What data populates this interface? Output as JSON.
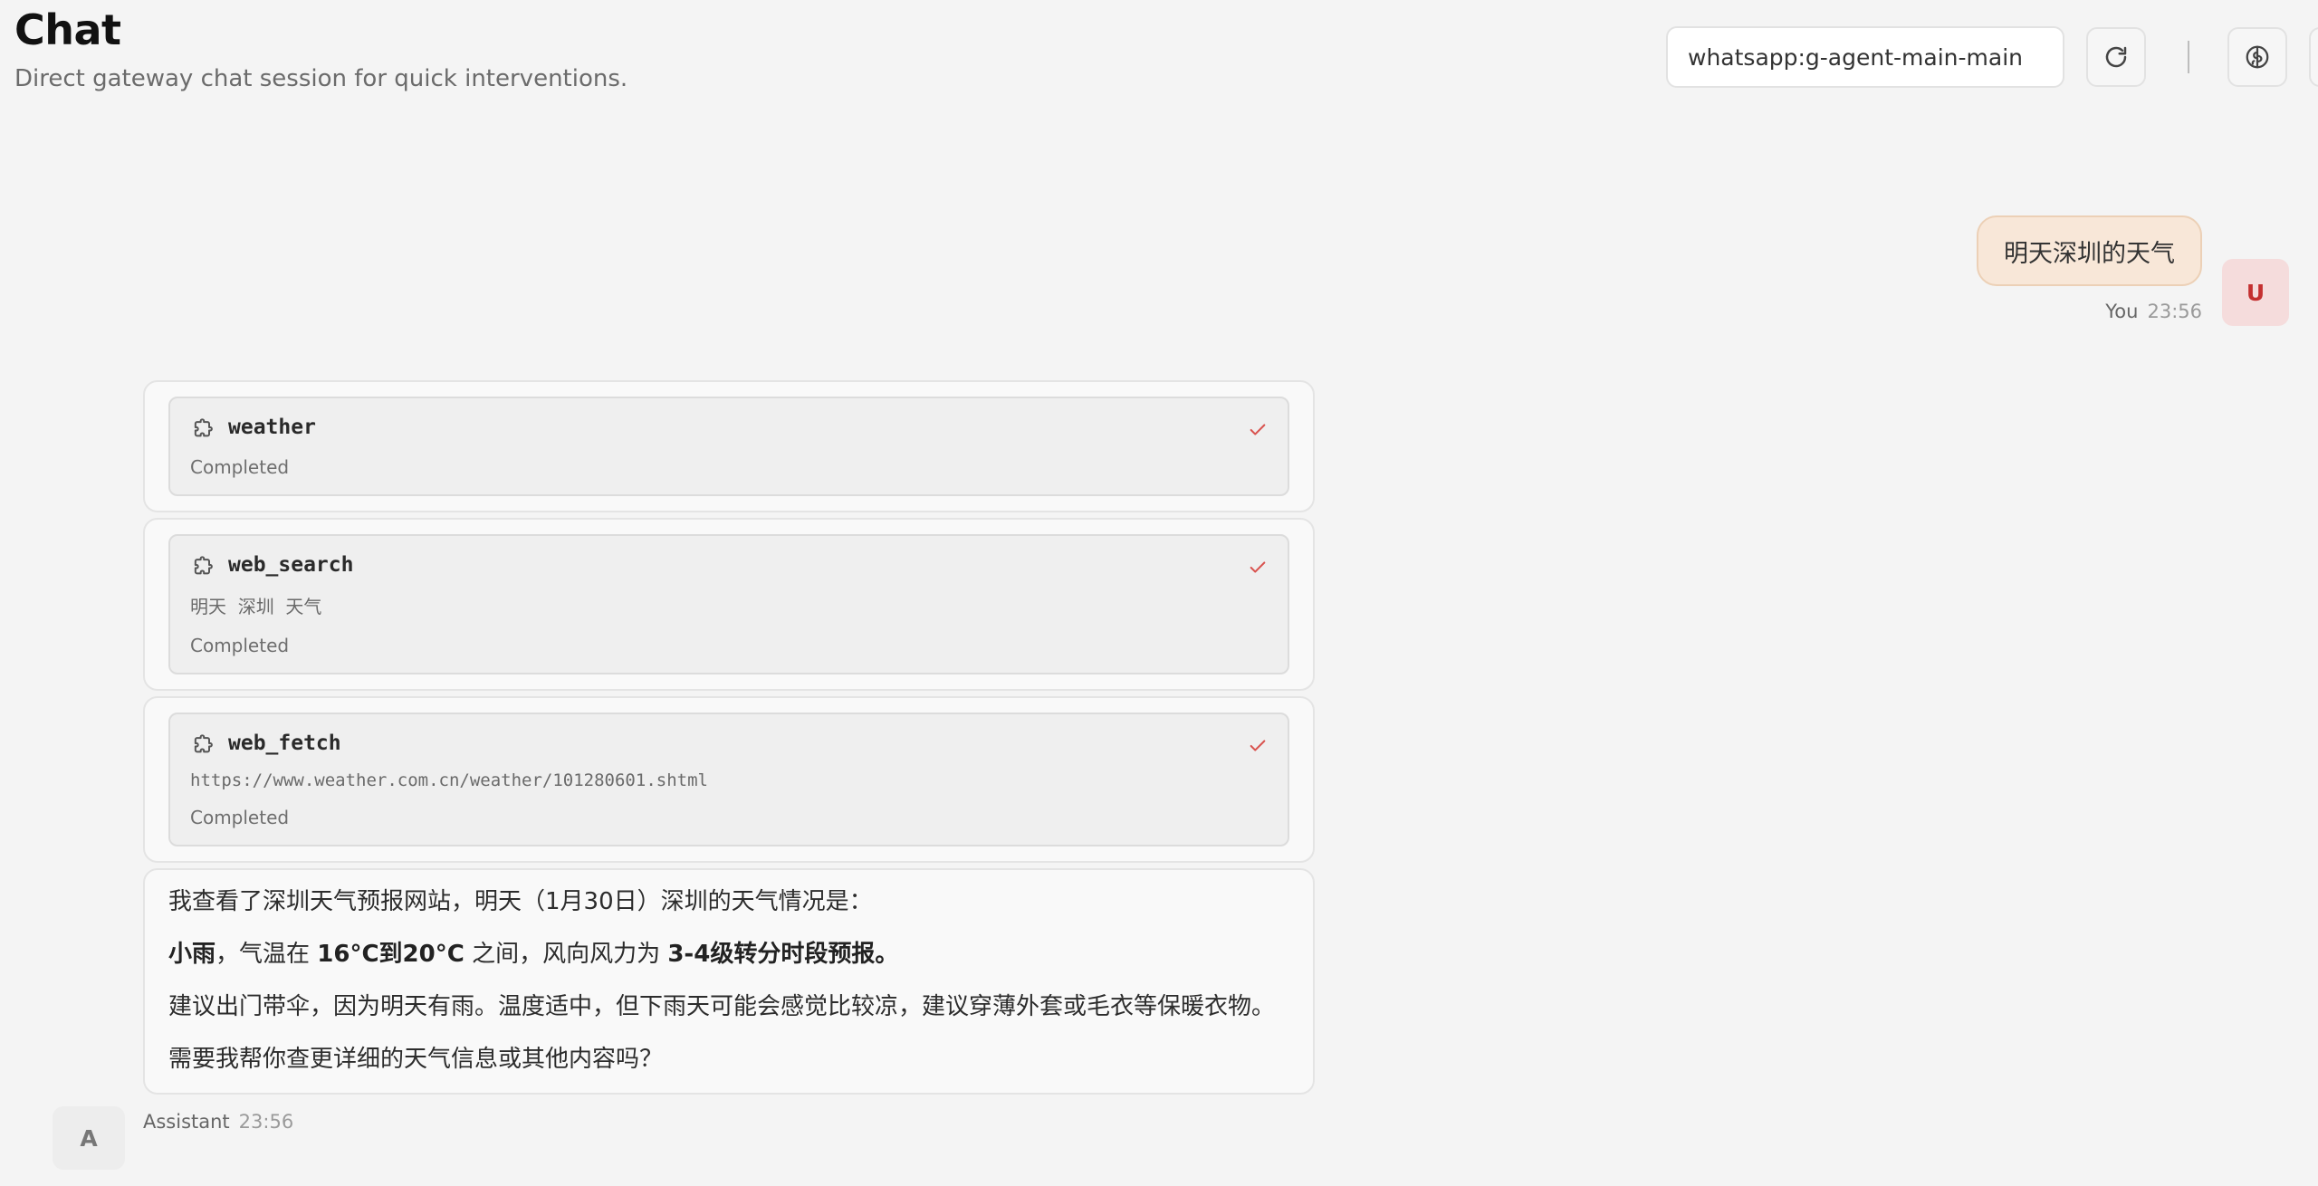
{
  "header": {
    "title": "Chat",
    "subtitle": "Direct gateway chat session for quick interventions."
  },
  "toolbar": {
    "session_key": "whatsapp:g-agent-main-main",
    "refresh_icon": "refresh-icon",
    "brain_icon": "brain-icon"
  },
  "messages": {
    "user": {
      "text": "明天深圳的天气",
      "sender": "You",
      "time": "23:56",
      "avatar": "U"
    },
    "assistant": {
      "sender": "Assistant",
      "time": "23:56",
      "avatar": "A",
      "tools": [
        {
          "name": "weather",
          "args": "",
          "status": "Completed"
        },
        {
          "name": "web_search",
          "args": "明天 深圳 天气",
          "status": "Completed"
        },
        {
          "name": "web_fetch",
          "args": "https://www.weather.com.cn/weather/101280601.shtml",
          "status": "Completed"
        }
      ],
      "reply": {
        "p1": "我查看了深圳天气预报网站，明天（1月30日）深圳的天气情况是：",
        "p2_a": "小雨",
        "p2_b": "，气温在 ",
        "p2_c": "16°C到20°C",
        "p2_d": " 之间，风向风力为 ",
        "p2_e": "3-4级转分时段预报。",
        "p3": "建议出门带伞，因为明天有雨。温度适中，但下雨天可能会感觉比较凉，建议穿薄外套或毛衣等保暖衣物。",
        "p4": "需要我帮你查更详细的天气信息或其他内容吗？"
      }
    }
  },
  "colors": {
    "background": "#f4f4f4",
    "accent": "#d9534f",
    "user_bubble": "#f8e7d8"
  }
}
